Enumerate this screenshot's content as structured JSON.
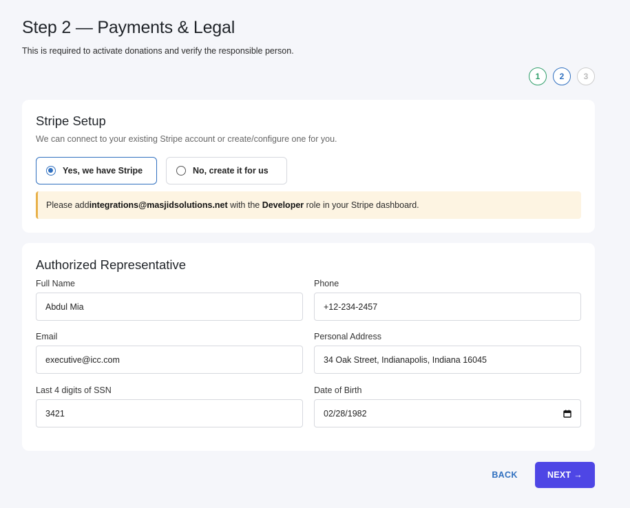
{
  "header": {
    "title": "Step 2 — Payments & Legal",
    "subtitle": "This is required to activate donations and verify the responsible person."
  },
  "stepper": {
    "steps": [
      {
        "label": "1",
        "state": "done"
      },
      {
        "label": "2",
        "state": "active"
      },
      {
        "label": "3",
        "state": "pending"
      }
    ],
    "colors": {
      "done": "#2f9e6a",
      "active": "#2f6fbf",
      "pending": "#cccccc"
    }
  },
  "stripe": {
    "title": "Stripe Setup",
    "description": "We can connect to your existing Stripe account or create/configure one for you.",
    "options": [
      {
        "label": "Yes, we have Stripe",
        "selected": true
      },
      {
        "label": "No, create it for us",
        "selected": false
      }
    ],
    "notice": {
      "prefix": "Please add ",
      "email": "integrations@masjidsolutions.net",
      "middle": " with the ",
      "role": "Developer",
      "suffix": " role in your Stripe dashboard."
    }
  },
  "representative": {
    "title": "Authorized Representative",
    "fields": {
      "full_name": {
        "label": "Full Name",
        "value": "Abdul Mia"
      },
      "phone": {
        "label": "Phone",
        "value": "+12-234-2457"
      },
      "email": {
        "label": "Email",
        "value": "executive@icc.com"
      },
      "address": {
        "label": "Personal Address",
        "value": "34 Oak Street, Indianapolis, Indiana 16045"
      },
      "ssn": {
        "label": "Last 4 digits of SSN",
        "value": "3421"
      },
      "dob": {
        "label": "Date of Birth",
        "value": "02/28/1982",
        "icon": "calendar-icon"
      }
    }
  },
  "footer": {
    "back_label": "BACK",
    "next_label": "NEXT →"
  },
  "colors": {
    "accent": "#4e46e5",
    "link": "#2f6fbf",
    "notice_bg": "#fdf4e2",
    "notice_border": "#e8b14a"
  }
}
